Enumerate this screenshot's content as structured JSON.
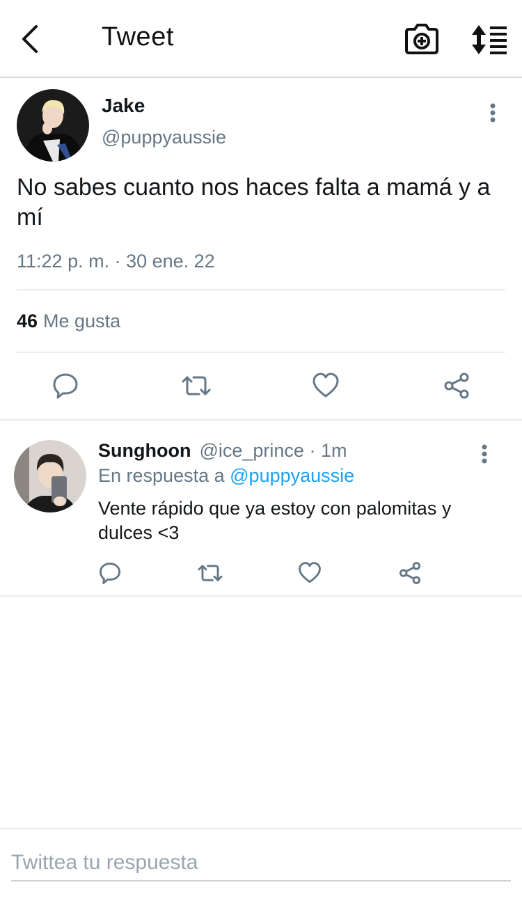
{
  "header": {
    "title": "Tweet",
    "back_icon": "chevron-left-icon",
    "camera_icon": "camera-add-icon",
    "sort_icon": "sort-list-icon"
  },
  "tweet": {
    "author_name": "Jake",
    "author_handle": "@puppyaussie",
    "text": "No sabes cuanto nos haces falta a mamá y a mí",
    "timestamp": "11:22 p. m. · 30 ene. 22",
    "likes_count": "46",
    "likes_label": "Me gusta",
    "actions": [
      "reply-icon",
      "retweet-icon",
      "like-icon",
      "share-icon"
    ]
  },
  "reply": {
    "author_name": "Sunghoon",
    "author_handle": "@ice_prince · 1m",
    "replying_prefix": "En respuesta a",
    "replying_to": "@puppyaussie",
    "text": "Vente rápido que ya estoy con palomitas y dulces <3"
  },
  "compose": {
    "placeholder": "Twittea tu respuesta"
  },
  "colors": {
    "text": "#14171a",
    "secondary": "#657786",
    "link": "#1da1f2",
    "divider": "#e6ecf0"
  }
}
